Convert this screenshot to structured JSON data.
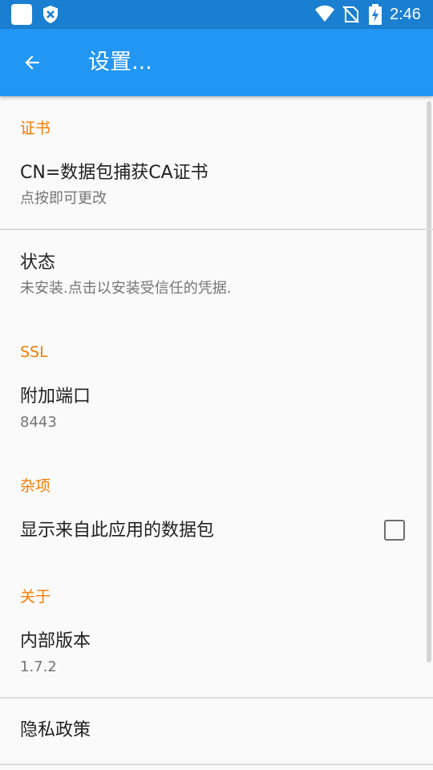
{
  "status_bar": {
    "time": "2:46",
    "icons": [
      "app-icon",
      "shield-icon",
      "wifi-icon",
      "no-sim-icon",
      "battery-charging-icon"
    ]
  },
  "app_bar": {
    "title": "设置...",
    "back_icon": "arrow-left-icon"
  },
  "sections": {
    "certificate": {
      "header": "证书",
      "ca_title": "CN=数据包捕获CA证书",
      "ca_summary": "点按即可更改",
      "status_title": "状态",
      "status_summary": "未安装.点击以安装受信任的凭据."
    },
    "ssl": {
      "header": "SSL",
      "port_title": "附加端口",
      "port_value": "8443"
    },
    "misc": {
      "header": "杂项",
      "show_packets_label": "显示来自此应用的数据包",
      "show_packets_checked": false
    },
    "about": {
      "header": "关于",
      "version_title": "内部版本",
      "version_value": "1.7.2",
      "privacy_label": "隐私政策"
    }
  },
  "colors": {
    "status_bar": "#1a7fd1",
    "app_bar": "#2196f3",
    "category": "#f57c00",
    "background": "#fafafa"
  }
}
